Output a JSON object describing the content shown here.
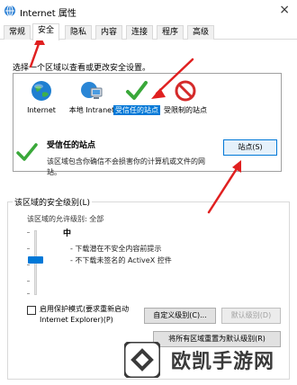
{
  "window": {
    "title": "Internet 属性"
  },
  "tabs": [
    {
      "label": "常规"
    },
    {
      "label": "安全"
    },
    {
      "label": "隐私"
    },
    {
      "label": "内容"
    },
    {
      "label": "连接"
    },
    {
      "label": "程序"
    },
    {
      "label": "高级"
    }
  ],
  "security": {
    "zone_prompt": "选择一个区域以查看或更改安全设置。",
    "zones": [
      {
        "label": "Internet",
        "icon": "globe-icon"
      },
      {
        "label": "本地 Intranet",
        "icon": "intranet-icon"
      },
      {
        "label": "受信任的站点",
        "icon": "checkmark-icon"
      },
      {
        "label": "受限制的站点",
        "icon": "restricted-icon"
      }
    ],
    "selected_zone": {
      "title": "受信任的站点",
      "description": "该区域包含你确信不会损害你的计算机或文件的网站。",
      "sites_button": "站点(S)"
    },
    "level_group": {
      "legend": "该区域的安全级别(L)",
      "allowed_label": "该区域的允许级别: 全部",
      "level_name": "中",
      "level_desc_1": "- 下载潜在不安全内容前提示",
      "level_desc_2": "- 不下载未签名的 ActiveX 控件",
      "protected_mode_label": "启用保护模式(要求重新启动 Internet Explorer)(P)",
      "custom_button": "自定义级别(C)...",
      "default_button": "默认级别(D)",
      "reset_all_button": "将所有区域重置为默认级别(R)"
    }
  },
  "watermark": {
    "text": "欧凯手游网"
  },
  "colors": {
    "accent": "#0078d7",
    "arrow": "#e02020",
    "check_green": "#3aa83a"
  }
}
